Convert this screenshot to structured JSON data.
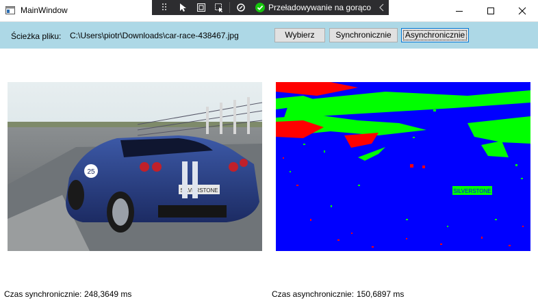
{
  "window": {
    "title": "MainWindow",
    "minimize_icon": "minimize-icon",
    "maximize_icon": "maximize-icon",
    "close_icon": "close-icon"
  },
  "devtools": {
    "hot_reload_label": "Przeładowywanie na gorąco",
    "status_color": "#16c60c"
  },
  "toolbar": {
    "path_label": "Ścieżka pliku:",
    "path_value": "C:\\Users\\piotr\\Downloads\\car-race-438467.jpg",
    "choose_button": "Wybierz",
    "sync_button": "Synchronicznie",
    "async_button": "Asynchronicznie",
    "background": "#add8e6"
  },
  "images": {
    "left_plate_text": "SILVERSTONE",
    "right_plate_text": "SILVERSTONE"
  },
  "stats": {
    "sync_label": "Czas synchronicznie:",
    "sync_value": "248,3649 ms",
    "async_label": "Czas asynchronicznie:",
    "async_value": "150,6897 ms"
  }
}
